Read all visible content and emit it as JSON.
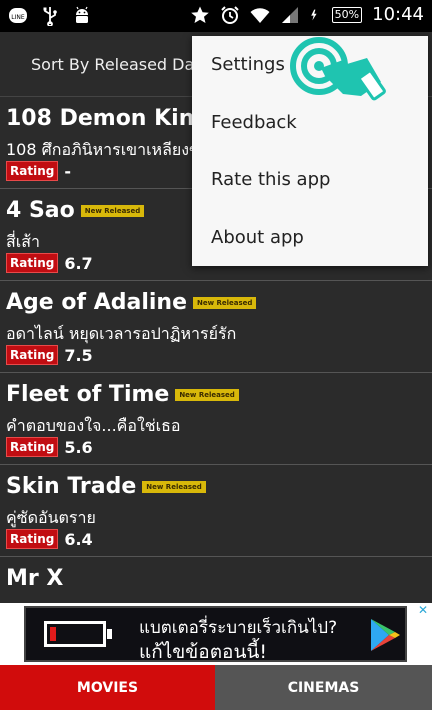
{
  "status_bar": {
    "time": "10:44",
    "battery": "50%",
    "icons": [
      "line-icon",
      "usb-icon",
      "android-icon",
      "star-icon",
      "alarm-icon",
      "wifi-icon",
      "signal-icon",
      "charging-icon"
    ]
  },
  "header": {
    "sort_label": "Sort By Released Date"
  },
  "menu": {
    "items": [
      {
        "label": "Settings"
      },
      {
        "label": "Feedback"
      },
      {
        "label": "Rate this app"
      },
      {
        "label": "About app"
      }
    ]
  },
  "movies": [
    {
      "title": "108 Demon Kings",
      "subtitle": "108 ศึกอภินิหารเขาเหลียงซาน",
      "rating_label": "Rating",
      "rating": "-",
      "new_badge": ""
    },
    {
      "title": "4 Sao",
      "subtitle": "สี่เส้า",
      "rating_label": "Rating",
      "rating": "6.7",
      "new_badge": "New Released"
    },
    {
      "title": "Age of Adaline",
      "subtitle": "อดาไลน์ หยุดเวลารอปาฏิหารย์รัก",
      "rating_label": "Rating",
      "rating": "7.5",
      "new_badge": "New Released"
    },
    {
      "title": "Fleet of Time",
      "subtitle": "คำตอบของใจ...คือใช่เธอ",
      "rating_label": "Rating",
      "rating": "5.6",
      "new_badge": "New Released"
    },
    {
      "title": "Skin Trade",
      "subtitle": "คู่ซัดอันตราย",
      "rating_label": "Rating",
      "rating": "6.4",
      "new_badge": "New Released"
    },
    {
      "title": "Mr X",
      "subtitle": "",
      "rating_label": "",
      "rating": "",
      "new_badge": ""
    }
  ],
  "ad": {
    "line1": "แบตเตอรี่ระบายเร็วเกินไป?",
    "line2": "แก้ไขข้อตอนนี้!",
    "battery_level": 0.1
  },
  "tabs": [
    {
      "label": "MOVIES",
      "active": true,
      "color": "#d10c0c"
    },
    {
      "label": "CINEMAS",
      "active": false,
      "color": "#555555"
    }
  ]
}
